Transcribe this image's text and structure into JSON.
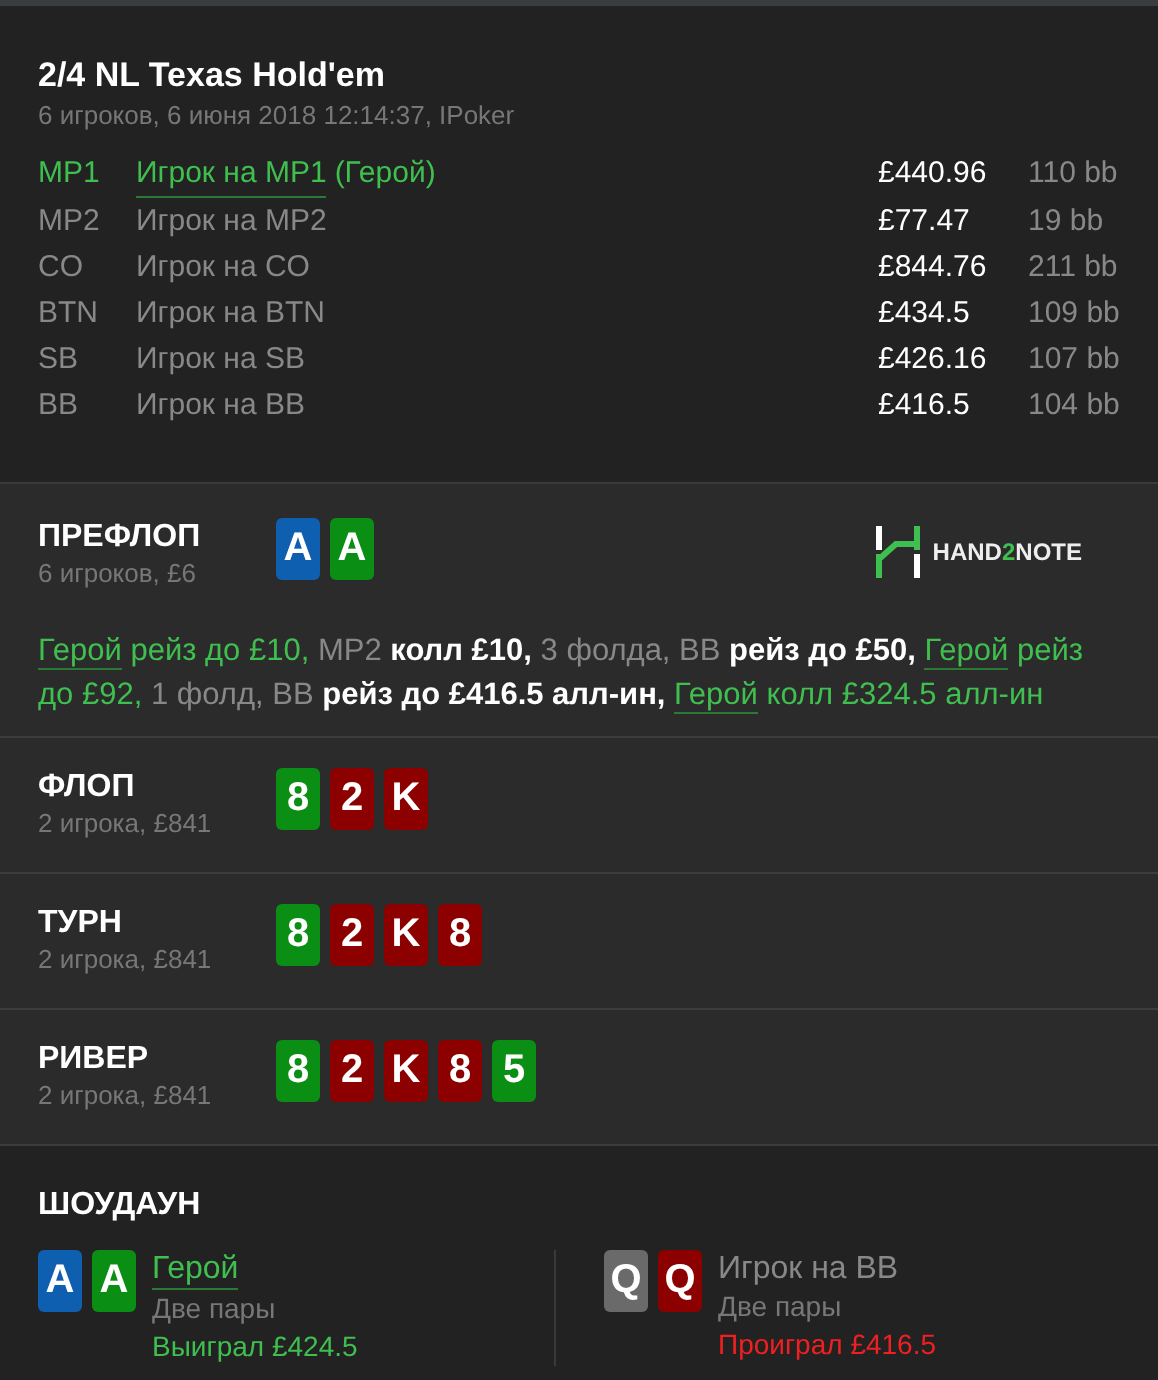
{
  "hand": {
    "title": "2/4 NL Texas Hold'em",
    "subtitle": "6 игроков, 6 июня 2018 12:14:37, IPoker"
  },
  "players": [
    {
      "position": "MP1",
      "name": "Игрок на MP1",
      "hero_label": "(Герой)",
      "hero": true,
      "stack": "£440.96",
      "bb": "110 bb"
    },
    {
      "position": "MP2",
      "name": "Игрок на MP2",
      "hero": false,
      "stack": "£77.47",
      "bb": "19 bb"
    },
    {
      "position": "CO",
      "name": "Игрок на CO",
      "hero": false,
      "stack": "£844.76",
      "bb": "211 bb"
    },
    {
      "position": "BTN",
      "name": "Игрок на BTN",
      "hero": false,
      "stack": "£434.5",
      "bb": "109 bb"
    },
    {
      "position": "SB",
      "name": "Игрок на SB",
      "hero": false,
      "stack": "£426.16",
      "bb": "107 bb"
    },
    {
      "position": "BB",
      "name": "Игрок на BB",
      "hero": false,
      "stack": "£416.5",
      "bb": "104 bb"
    }
  ],
  "streets": [
    {
      "name": "ПРЕФЛОП",
      "info": "6 игроков, £6",
      "cards": [
        {
          "rank": "A",
          "color": "#0f5fb0"
        },
        {
          "rank": "A",
          "color": "#0a8f14"
        }
      ],
      "logo": {
        "before": "HAND",
        "accent": "2",
        "after": "NOTE"
      },
      "actions": [
        {
          "kind": "hero",
          "text": "Герой"
        },
        {
          "kind": "hero-action",
          "text": " рейз до £10, "
        },
        {
          "kind": "player",
          "text": "MP2"
        },
        {
          "kind": "action",
          "text": " колл £10, "
        },
        {
          "kind": "player",
          "text": "3 фолда, BB"
        },
        {
          "kind": "action",
          "text": " рейз до £50, "
        },
        {
          "kind": "hero",
          "text": "Герой"
        },
        {
          "kind": "hero-action",
          "text": " рейз до £92, "
        },
        {
          "kind": "player",
          "text": "1 фолд, BB"
        },
        {
          "kind": "action",
          "text": " рейз до £416.5 алл-ин, "
        },
        {
          "kind": "hero",
          "text": "Герой"
        },
        {
          "kind": "hero-action",
          "text": " колл £324.5 алл-ин"
        }
      ]
    },
    {
      "name": "ФЛОП",
      "info": "2 игрока, £841",
      "cards": [
        {
          "rank": "8",
          "color": "#0a8f14"
        },
        {
          "rank": "2",
          "color": "#8c0000"
        },
        {
          "rank": "K",
          "color": "#8c0000"
        }
      ]
    },
    {
      "name": "ТУРН",
      "info": "2 игрока, £841",
      "cards": [
        {
          "rank": "8",
          "color": "#0a8f14"
        },
        {
          "rank": "2",
          "color": "#8c0000"
        },
        {
          "rank": "K",
          "color": "#8c0000"
        },
        {
          "rank": "8",
          "color": "#8c0000"
        }
      ]
    },
    {
      "name": "РИВЕР",
      "info": "2 игрока, £841",
      "cards": [
        {
          "rank": "8",
          "color": "#0a8f14"
        },
        {
          "rank": "2",
          "color": "#8c0000"
        },
        {
          "rank": "K",
          "color": "#8c0000"
        },
        {
          "rank": "8",
          "color": "#8c0000"
        },
        {
          "rank": "5",
          "color": "#0a8f14"
        }
      ]
    }
  ],
  "showdown": {
    "title": "ШОУДАУН",
    "hands": [
      {
        "cards": [
          {
            "rank": "A",
            "color": "#0f5fb0"
          },
          {
            "rank": "A",
            "color": "#0a8f14"
          }
        ],
        "name": "Герой",
        "hero": true,
        "combo": "Две пары",
        "result": "Выиграл £424.5",
        "color": "#3fbf4f"
      },
      {
        "cards": [
          {
            "rank": "Q",
            "color": "#6a6a6a"
          },
          {
            "rank": "Q",
            "color": "#8c0000"
          }
        ],
        "name": "Игрок на BB",
        "hero": false,
        "combo": "Две пары",
        "result": "Проиграл £416.5",
        "color": "#f02020"
      }
    ]
  }
}
